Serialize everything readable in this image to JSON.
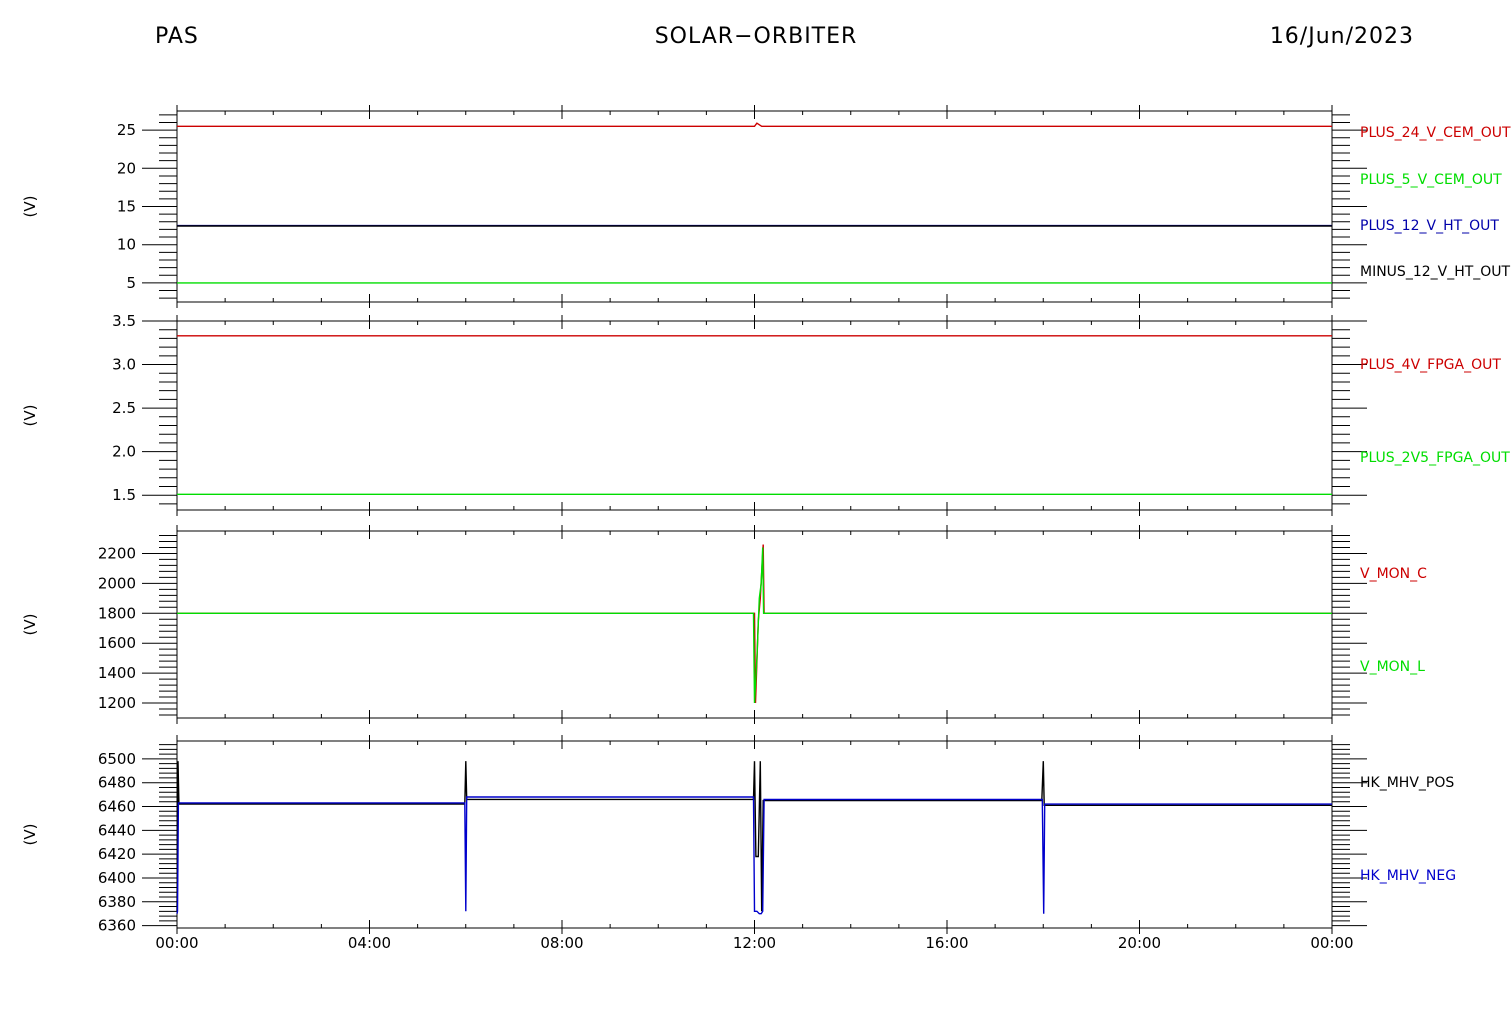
{
  "header": {
    "left": "PAS",
    "center": "SOLAR−ORBITER",
    "right": "16/Jun/2023"
  },
  "chart_data": [
    {
      "type": "line",
      "ylabel": "(V)",
      "ylim": [
        2.5,
        27.5
      ],
      "yticks": [
        5,
        10,
        15,
        20,
        25
      ],
      "yticklabels": [
        "5",
        "10",
        "15",
        "20",
        "25"
      ],
      "xlim": [
        0,
        24
      ],
      "series": [
        {
          "name": "PLUS_24_V_CEM_OUT",
          "color": "#cc0000",
          "x": [
            0,
            12.0,
            12.05,
            12.15,
            24
          ],
          "y": [
            25.5,
            25.5,
            25.9,
            25.5,
            25.5
          ]
        },
        {
          "name": "PLUS_5_V_CEM_OUT",
          "color": "#00dd00",
          "x": [
            0,
            24
          ],
          "y": [
            5.0,
            5.0
          ]
        },
        {
          "name": "PLUS_12_V_HT_OUT",
          "color": "#0000aa",
          "x": [
            0,
            24
          ],
          "y": [
            12.5,
            12.5
          ]
        },
        {
          "name": "MINUS_12_V_HT_OUT",
          "color": "#000000",
          "x": [
            0,
            24
          ],
          "y": [
            12.45,
            12.45
          ]
        }
      ]
    },
    {
      "type": "line",
      "ylabel": "(V)",
      "ylim": [
        1.33,
        3.5
      ],
      "yticks": [
        1.5,
        2.0,
        2.5,
        3.0,
        3.5
      ],
      "yticklabels": [
        "1.5",
        "2.0",
        "2.5",
        "3.0",
        "3.5"
      ],
      "xlim": [
        0,
        24
      ],
      "series": [
        {
          "name": "PLUS_4V_FPGA_OUT",
          "color": "#cc0000",
          "x": [
            0,
            24
          ],
          "y": [
            3.33,
            3.33
          ]
        },
        {
          "name": "PLUS_2V5_FPGA_OUT",
          "color": "#00dd00",
          "x": [
            0,
            24
          ],
          "y": [
            1.51,
            1.51
          ]
        }
      ]
    },
    {
      "type": "line",
      "ylabel": "(V)",
      "ylim": [
        1100,
        2350
      ],
      "yticks": [
        1200,
        1400,
        1600,
        1800,
        2000,
        2200
      ],
      "yticklabels": [
        "1200",
        "1400",
        "1600",
        "1800",
        "2000",
        "2200"
      ],
      "xlim": [
        0,
        24
      ],
      "series": [
        {
          "name": "V_MON_C",
          "color": "#cc0000",
          "x": [
            0,
            12.0,
            12.02,
            12.08,
            12.12,
            12.18,
            12.2,
            24
          ],
          "y": [
            1800,
            1800,
            1200,
            1750,
            1900,
            2260,
            1800,
            1800
          ]
        },
        {
          "name": "V_MON_L",
          "color": "#00dd00",
          "x": [
            0,
            11.98,
            12.0,
            12.05,
            12.1,
            12.14,
            12.17,
            12.19,
            24
          ],
          "y": [
            1800,
            1800,
            1200,
            1500,
            1900,
            2000,
            2240,
            1800,
            1800
          ]
        }
      ]
    },
    {
      "type": "line",
      "ylabel": "(V)",
      "ylim": [
        6358,
        6515
      ],
      "yticks": [
        6360,
        6380,
        6400,
        6420,
        6440,
        6460,
        6480,
        6500
      ],
      "yticklabels": [
        "6360",
        "6380",
        "6400",
        "6420",
        "6440",
        "6460",
        "6480",
        "6500"
      ],
      "xlim": [
        0,
        24
      ],
      "xticks": [
        0,
        4,
        8,
        12,
        16,
        20,
        24
      ],
      "xticklabels": [
        "00:00",
        "04:00",
        "08:00",
        "12:00",
        "16:00",
        "20:00",
        "00:00"
      ],
      "series": [
        {
          "name": "HK_MHV_POS",
          "color": "#000000",
          "x": [
            0,
            0.02,
            0.04,
            5.98,
            6.0,
            6.02,
            6.04,
            11.98,
            12.0,
            12.03,
            12.08,
            12.12,
            12.15,
            12.18,
            17.97,
            18.0,
            18.02,
            24
          ],
          "y": [
            6372,
            6498,
            6462,
            6462,
            6498,
            6466,
            6466,
            6466,
            6498,
            6418,
            6418,
            6498,
            6372,
            6465,
            6465,
            6498,
            6461,
            6461
          ]
        },
        {
          "name": "HK_MHV_NEG",
          "color": "#0000cc",
          "x": [
            0,
            0.01,
            0.03,
            5.98,
            6.0,
            6.02,
            6.04,
            11.98,
            12.0,
            12.05,
            12.1,
            12.14,
            12.17,
            12.2,
            17.98,
            18.01,
            18.03,
            24
          ],
          "y": [
            6370,
            6372,
            6463,
            6463,
            6372,
            6468,
            6468,
            6468,
            6372,
            6372,
            6370,
            6370,
            6372,
            6466,
            6466,
            6370,
            6462,
            6462
          ]
        }
      ]
    }
  ]
}
